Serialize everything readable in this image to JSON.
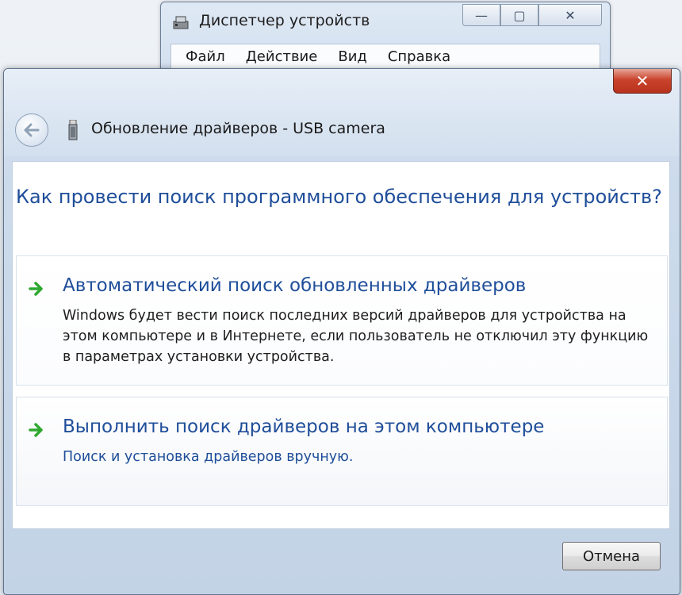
{
  "background_window": {
    "title": "Диспетчер устройств",
    "menu": [
      "Файл",
      "Действие",
      "Вид",
      "Справка"
    ],
    "controls": {
      "minimize": "—",
      "maximize": "▢",
      "close": "✕"
    }
  },
  "dialog": {
    "close_glyph": "✕",
    "title": "Обновление драйверов - USB camera",
    "question": "Как провести поиск программного обеспечения для устройств?",
    "options": [
      {
        "title": "Автоматический поиск обновленных драйверов",
        "description": "Windows будет вести поиск последних версий драйверов для устройства на этом компьютере и в Интернете, если пользователь не отключил эту функцию в параметрах установки устройства."
      },
      {
        "title": "Выполнить поиск драйверов на этом компьютере",
        "description": "Поиск и установка драйверов вручную."
      }
    ],
    "cancel_label": "Отмена"
  },
  "icons": {
    "back": "back-arrow-icon",
    "usb": "usb-device-icon",
    "option_arrow": "green-arrow-icon"
  },
  "colors": {
    "link_blue": "#1f4e9a",
    "close_red": "#c9432c",
    "arrow_green": "#2fa830"
  }
}
